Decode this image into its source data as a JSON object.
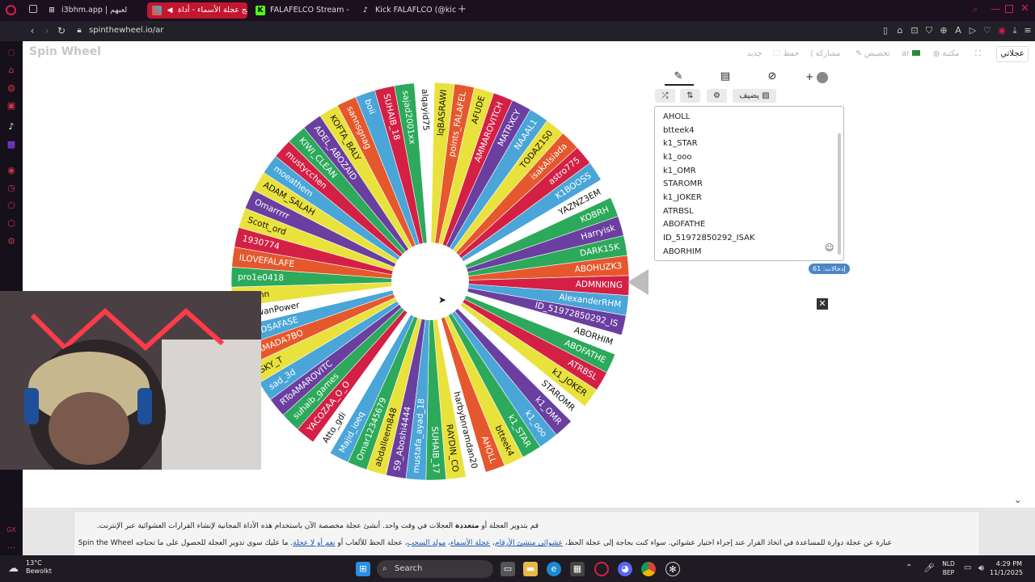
{
  "browser": {
    "tabs": [
      {
        "label": "i3bhm.app | لعبهم",
        "icon": "tab-favicon-i3bhm",
        "active": false
      },
      {
        "label": "برنامج عجلة الأسماء - أداة",
        "icon": "tab-favicon-spinthewheel",
        "active": true
      },
      {
        "label": "FALAFELCO Stream - Wa",
        "icon": "kick-icon",
        "active": false
      },
      {
        "label": "Kick FALAFLCO (@kick_fa",
        "icon": "tiktok-icon",
        "active": false
      }
    ],
    "url": "spinthewheel.io/ar"
  },
  "site": {
    "logo": "Spin Wheel",
    "toolbar": {
      "new": "جديد",
      "save": "حفظ",
      "share": "مشاركة",
      "customize": "تخصيص",
      "language": "ar",
      "gallery": "مكتبة",
      "my_wheels": "عجلاتي"
    }
  },
  "panel": {
    "tabs": [
      "edit-icon",
      "results-icon",
      "hide-icon",
      "add-icon"
    ],
    "buttons": {
      "shuffle": "shuffle-icon",
      "sort": "sort-icon",
      "settings": "gear-icon",
      "add_image": "يضيف"
    },
    "entries": [
      "AHOLL",
      "btteek4",
      "k1_STAR",
      "k1_ooo",
      "k1_OMR",
      "STAROMR",
      "k1_JOKER",
      "ATRBSL",
      "ABOFATHE",
      "ID_51972850292_ISAK",
      "ABORHIM"
    ],
    "count_label": "إدخالات: 61"
  },
  "wheel": {
    "segments": [
      {
        "label": "KOBRH",
        "color": "#2ca95a"
      },
      {
        "label": "Harryisk",
        "color": "#6a3fa0"
      },
      {
        "label": "DARK15K",
        "color": "#2ca95a"
      },
      {
        "label": "ABOHUZK3",
        "color": "#e5582d"
      },
      {
        "label": "ADMNKING",
        "color": "#d42045"
      },
      {
        "label": "AlexanderRHM",
        "color": "#4aa5d8"
      },
      {
        "label": "ID_51972850292_IS",
        "color": "#6a3fa0"
      },
      {
        "label": "ABORHIM",
        "color": "#ffffff"
      },
      {
        "label": "ABOFATHE",
        "color": "#2ca95a"
      },
      {
        "label": "ATRBSL",
        "color": "#d42045"
      },
      {
        "label": "k1_JOKER",
        "color": "#eae23c"
      },
      {
        "label": "STAROMR",
        "color": "#ffffff"
      },
      {
        "label": "k1_OMR",
        "color": "#6a3fa0"
      },
      {
        "label": "k1_ooo",
        "color": "#4aa5d8"
      },
      {
        "label": "k1_STAR",
        "color": "#2ca95a"
      },
      {
        "label": "btteek4",
        "color": "#eae23c"
      },
      {
        "label": "AHOLL",
        "color": "#e5582d"
      },
      {
        "label": "harbybnramdan20",
        "color": "#ffffff"
      },
      {
        "label": "RAYDIN_CO",
        "color": "#eae23c"
      },
      {
        "label": "SUHAIB_17",
        "color": "#2ca95a"
      },
      {
        "label": "mustafa_ayad_18",
        "color": "#4aa5d8"
      },
      {
        "label": "S9_Aboshi4444",
        "color": "#6a3fa0"
      },
      {
        "label": "abdalleem848",
        "color": "#eae23c"
      },
      {
        "label": "Omar12345679",
        "color": "#2ca95a"
      },
      {
        "label": "Majid_ioeq",
        "color": "#4aa5d8"
      },
      {
        "label": "Atto_gdi",
        "color": "#ffffff"
      },
      {
        "label": "YACOZAA_O_O",
        "color": "#d42045"
      },
      {
        "label": "suhaib_games",
        "color": "#2ca95a"
      },
      {
        "label": "RToAMAROVITC",
        "color": "#6a3fa0"
      },
      {
        "label": "sad_3d",
        "color": "#4aa5d8"
      },
      {
        "label": "SKY_T",
        "color": "#eae23c"
      },
      {
        "label": "HAMADA7BO",
        "color": "#e5582d"
      },
      {
        "label": "SAFDSAFASE",
        "color": "#4aa5d8"
      },
      {
        "label": "RadwanPower",
        "color": "#ffffff"
      },
      {
        "label": "asd3nn",
        "color": "#eae23c"
      },
      {
        "label": "pro1e0418",
        "color": "#2ca95a"
      },
      {
        "label": "ILOVEFALAFE",
        "color": "#e5582d"
      },
      {
        "label": "1930774",
        "color": "#d42045"
      },
      {
        "label": "Scott_ord",
        "color": "#eae23c"
      },
      {
        "label": "Omarrrrr",
        "color": "#6a3fa0"
      },
      {
        "label": "ADAM_SALAH",
        "color": "#eae23c"
      },
      {
        "label": "moeathem",
        "color": "#4aa5d8"
      },
      {
        "label": "mustycchen",
        "color": "#d42045"
      },
      {
        "label": "KIWI_CLEAN",
        "color": "#2ca95a"
      },
      {
        "label": "ADEL_ABOZAID",
        "color": "#6a3fa0"
      },
      {
        "label": "KOFTA_BALY",
        "color": "#eae23c"
      },
      {
        "label": "sannsgnag",
        "color": "#e5582d"
      },
      {
        "label": "boii",
        "color": "#4aa5d8"
      },
      {
        "label": "SUHAIB_18",
        "color": "#d42045"
      },
      {
        "label": "sajad2001xx",
        "color": "#2ca95a"
      },
      {
        "label": "alqayid75",
        "color": "#ffffff"
      },
      {
        "label": "lqBASRAWI",
        "color": "#eae23c"
      },
      {
        "label": "points_FALAFEL",
        "color": "#e5582d"
      },
      {
        "label": "AFUDE",
        "color": "#eae23c"
      },
      {
        "label": "AMMAROVITCH",
        "color": "#d42045"
      },
      {
        "label": "MATRXCY",
        "color": "#6a3fa0"
      },
      {
        "label": "NAAAL1",
        "color": "#4aa5d8"
      },
      {
        "label": "TODAZ1S0",
        "color": "#eae23c"
      },
      {
        "label": "isakAlsiada",
        "color": "#e5582d"
      },
      {
        "label": "astro775",
        "color": "#d42045"
      },
      {
        "label": "K1BOOSS",
        "color": "#4aa5d8"
      },
      {
        "label": "YAZNZ3EM",
        "color": "#ffffff"
      }
    ]
  },
  "description": {
    "line1_pre": "قم بتدوير العجلة أو ",
    "line1_bold": "متعددة",
    "line1_post": " العجلات في وقت واحد. أنشئ عجلة مخصصة الآن باستخدام هذه الأداة المجانية لإنشاء القرارات العشوائية عبر الإنترنت.",
    "line2_pre": "عبارة عن عجلة دوارة للمساعدة في اتخاذ القرار عند إجراء اختيار عشوائي. سواء كنت بحاجة إلى عجلة الحظ، ",
    "link1": "عشوائي منشئ الأرقام",
    "sep1": "، ",
    "link2": "عجلة الأسماء",
    "sep2": "، ",
    "link3": "مولد السحب",
    "line2_mid": "، عجلة الحظ للألعاب أو ",
    "link4": "نعم أو لا عجلة",
    "line2_post": ". ما عليك سوى تدوير العجلة للحصول على ما تحتاجه ",
    "brand": "Spin the Wheel"
  },
  "taskbar": {
    "weather_temp": "13°C",
    "weather_desc": "Bewolkt",
    "search": "Search",
    "lang1": "NLD",
    "lang2": "BEP",
    "time": "4:29 PM",
    "date": "11/1/2025"
  }
}
